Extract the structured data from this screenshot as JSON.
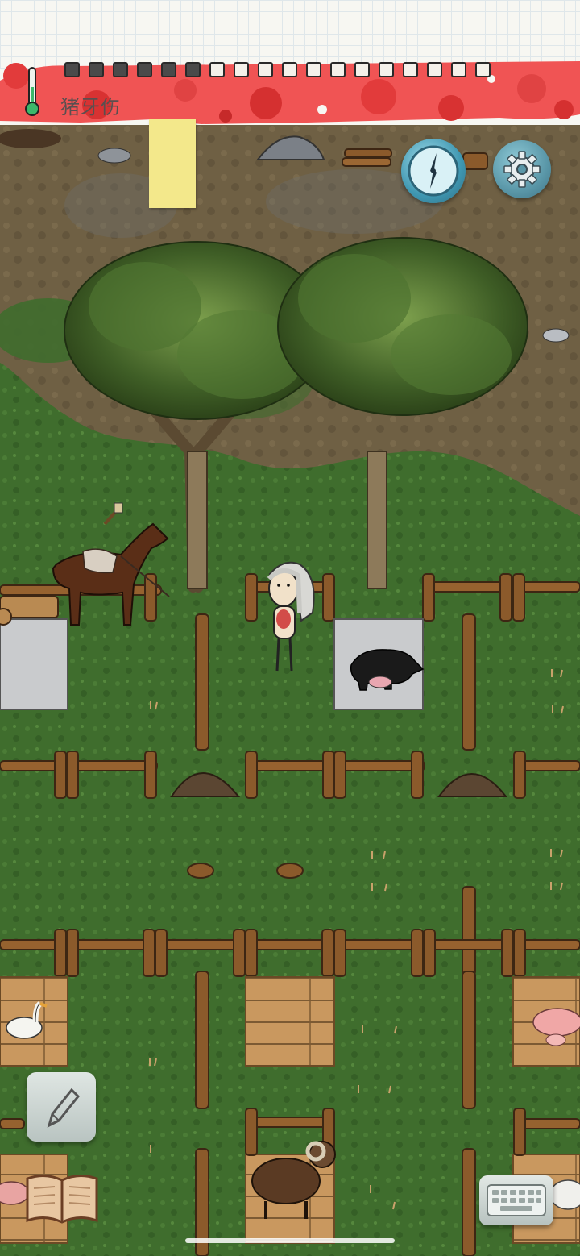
{
  "status": {
    "effect_text": "猪牙伤",
    "food_pips_total": 18,
    "food_pips_filled": 6,
    "status_color": "#e23b3b"
  },
  "ui": {
    "compass_label": "compass-icon",
    "settings_label": "gear-icon",
    "pencil_label": "pencil-icon",
    "book_label": "open-book-icon",
    "keyboard_label": "keyboard-icon",
    "note_color": "#f3e88b"
  },
  "colors": {
    "grass": "#3e6b2c",
    "dirt": "#6e5e43",
    "fence": "#8a5a2b",
    "floor_wood": "#c99a63",
    "stone_floor": "#c8c8c8"
  }
}
